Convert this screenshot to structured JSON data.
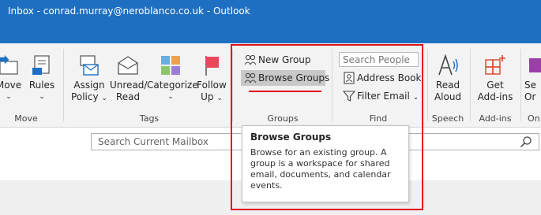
{
  "window": {
    "title": "Inbox - conrad.murray@neroblanco.co.uk  -  Outlook"
  },
  "ribbon": {
    "move": {
      "move_label": "Move",
      "rules_label": "Rules",
      "group_label": "Move"
    },
    "tags": {
      "assign_policy_label_1": "Assign",
      "assign_policy_label_2": "Policy",
      "unread_read_label_1": "Unread/",
      "unread_read_label_2": "Read",
      "categorize_label": "Categorize",
      "follow_up_label_1": "Follow",
      "follow_up_label_2": "Up",
      "group_label": "Tags"
    },
    "groups": {
      "new_group_label": "New Group",
      "browse_groups_label": "Browse Groups",
      "group_label": "Groups"
    },
    "find": {
      "search_people_placeholder": "Search People",
      "address_book_label": "Address Book",
      "filter_email_label": "Filter Email",
      "group_label": "Find"
    },
    "speech": {
      "read_aloud_label_1": "Read",
      "read_aloud_label_2": "Aloud",
      "group_label": "Speech"
    },
    "addins": {
      "get_addins_label_1": "Get",
      "get_addins_label_2": "Add-ins",
      "group_label": "Add-ins"
    },
    "cutoff": {
      "label_1": "Se",
      "label_2": "Or",
      "group_label": "On"
    }
  },
  "mailbox_search": {
    "placeholder": "Search Current Mailbox"
  },
  "tooltip": {
    "title": "Browse Groups",
    "body": "Browse for an existing group. A group is a workspace for shared email, documents, and calendar events."
  },
  "colors": {
    "titlebar": "#1e6fc2",
    "highlight_red": "#e0101b",
    "accent_blue": "#1e6fc2"
  }
}
